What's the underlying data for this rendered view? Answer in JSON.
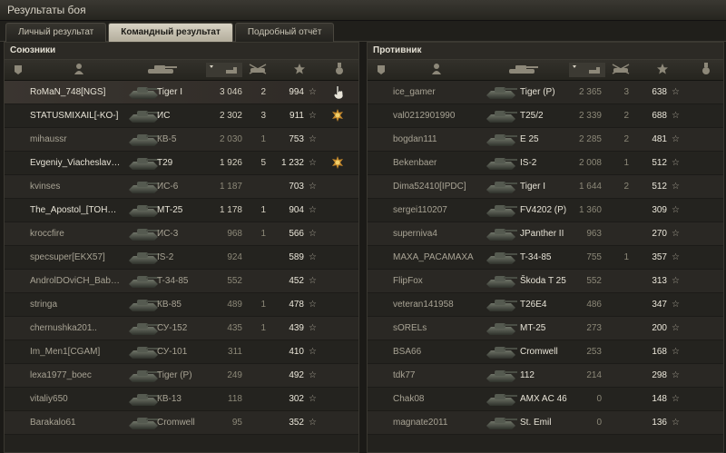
{
  "window": {
    "title": "Результаты боя"
  },
  "tabs": [
    {
      "label": "Личный результат",
      "active": false
    },
    {
      "label": "Командный результат",
      "active": true
    },
    {
      "label": "Подробный отчёт",
      "active": false
    }
  ],
  "allies": {
    "title": "Союзники",
    "rows": [
      {
        "player": "RoMaN_748[NGS]",
        "tank": "Tiger I",
        "damage": "3 046",
        "kills": "2",
        "points": "994",
        "alive": true,
        "highlight": true,
        "medal": false
      },
      {
        "player": "STATUSMIXAIL[-KO-]",
        "tank": "ИС",
        "damage": "2 302",
        "kills": "3",
        "points": "911",
        "alive": true,
        "highlight": false,
        "medal": true
      },
      {
        "player": "mihaussr",
        "tank": "КВ-5",
        "damage": "2 030",
        "kills": "1",
        "points": "753",
        "alive": false,
        "highlight": false,
        "medal": false
      },
      {
        "player": "Evgeniy_Viacheslavo..",
        "tank": "T29",
        "damage": "1 926",
        "kills": "5",
        "points": "1 232",
        "alive": true,
        "highlight": false,
        "medal": true
      },
      {
        "player": "kvinses",
        "tank": "ИС-6",
        "damage": "1 187",
        "kills": "",
        "points": "703",
        "alive": false,
        "highlight": false,
        "medal": false
      },
      {
        "player": "The_Apostol_[TOHHA]",
        "tank": "MT-25",
        "damage": "1 178",
        "kills": "1",
        "points": "904",
        "alive": true,
        "highlight": false,
        "medal": false
      },
      {
        "player": "kroccfire",
        "tank": "ИС-3",
        "damage": "968",
        "kills": "1",
        "points": "566",
        "alive": false,
        "highlight": false,
        "medal": false
      },
      {
        "player": "specsuper[EKX57]",
        "tank": "IS-2",
        "damage": "924",
        "kills": "",
        "points": "589",
        "alive": false,
        "highlight": false,
        "medal": false
      },
      {
        "player": "AndrolDOviCH_Babai..",
        "tank": "T-34-85",
        "damage": "552",
        "kills": "",
        "points": "452",
        "alive": false,
        "highlight": false,
        "medal": false
      },
      {
        "player": "stringa",
        "tank": "КВ-85",
        "damage": "489",
        "kills": "1",
        "points": "478",
        "alive": false,
        "highlight": false,
        "medal": false
      },
      {
        "player": "chernushka201..",
        "tank": "СУ-152",
        "damage": "435",
        "kills": "1",
        "points": "439",
        "alive": false,
        "highlight": false,
        "medal": false
      },
      {
        "player": "Im_Men1[CGAM]",
        "tank": "СУ-101",
        "damage": "311",
        "kills": "",
        "points": "410",
        "alive": false,
        "highlight": false,
        "medal": false
      },
      {
        "player": "lexa1977_boec",
        "tank": "Tiger (P)",
        "damage": "249",
        "kills": "",
        "points": "492",
        "alive": false,
        "highlight": false,
        "medal": false
      },
      {
        "player": "vitaliy650",
        "tank": "КВ-13",
        "damage": "118",
        "kills": "",
        "points": "302",
        "alive": false,
        "highlight": false,
        "medal": false
      },
      {
        "player": "Barakalo61",
        "tank": "Cromwell",
        "damage": "95",
        "kills": "",
        "points": "352",
        "alive": false,
        "highlight": false,
        "medal": false
      }
    ]
  },
  "enemies": {
    "title": "Противник",
    "rows": [
      {
        "player": "ice_gamer",
        "tank": "Tiger (P)",
        "damage": "2 365",
        "kills": "3",
        "points": "638"
      },
      {
        "player": "val0212901990",
        "tank": "T25/2",
        "damage": "2 339",
        "kills": "2",
        "points": "688"
      },
      {
        "player": "bogdan111",
        "tank": "E 25",
        "damage": "2 285",
        "kills": "2",
        "points": "481"
      },
      {
        "player": "Bekenbaer",
        "tank": "IS-2",
        "damage": "2 008",
        "kills": "1",
        "points": "512"
      },
      {
        "player": "Dima52410[IPDC]",
        "tank": "Tiger I",
        "damage": "1 644",
        "kills": "2",
        "points": "512"
      },
      {
        "player": "sergei110207",
        "tank": "FV4202 (P)",
        "damage": "1 360",
        "kills": "",
        "points": "309"
      },
      {
        "player": "superniva4",
        "tank": "JPanther II",
        "damage": "963",
        "kills": "",
        "points": "270"
      },
      {
        "player": "MAXA_PACAMAXA",
        "tank": "T-34-85",
        "damage": "755",
        "kills": "1",
        "points": "357"
      },
      {
        "player": "FlipFox",
        "tank": "Škoda T 25",
        "damage": "552",
        "kills": "",
        "points": "313"
      },
      {
        "player": "veteran141958",
        "tank": "T26E4",
        "damage": "486",
        "kills": "",
        "points": "347"
      },
      {
        "player": "sORELs",
        "tank": "MT-25",
        "damage": "273",
        "kills": "",
        "points": "200"
      },
      {
        "player": "BSA66",
        "tank": "Cromwell",
        "damage": "253",
        "kills": "",
        "points": "168"
      },
      {
        "player": "tdk77",
        "tank": "112",
        "damage": "214",
        "kills": "",
        "points": "298"
      },
      {
        "player": "Chak08",
        "tank": "AMX AC 46",
        "damage": "0",
        "kills": "",
        "points": "148"
      },
      {
        "player": "magnate2011",
        "tank": "St. Emil",
        "damage": "0",
        "kills": "",
        "points": "136"
      }
    ]
  },
  "icons": {
    "column_platoon": "squad-icon",
    "column_player": "player-icon",
    "column_tank": "tank-icon",
    "column_damage": "damage-icon",
    "column_kills": "kills-icon",
    "column_xp": "star-icon",
    "column_medal": "medal-icon"
  }
}
